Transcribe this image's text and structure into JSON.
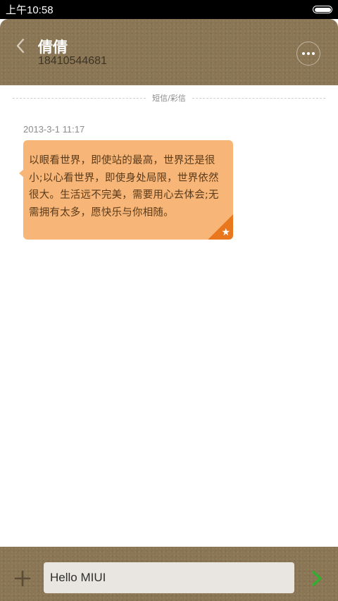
{
  "status_bar": {
    "time": "上午10:58"
  },
  "header": {
    "contact_name": "倩倩",
    "phone_number": "18410544681"
  },
  "conversation": {
    "divider_label": "短信/彩信",
    "messages": [
      {
        "timestamp": "2013-3-1 11:17",
        "text": "以眼看世界，即使站的最高，世界还是很小;以心看世界，即使身处局限，世界依然很大。生活远不完美，需要用心去体会;无需拥有太多，愿快乐与你相随。",
        "starred": true
      }
    ]
  },
  "composer": {
    "input_value": "Hello MIUI"
  },
  "colors": {
    "header_bg": "#8a7654",
    "bubble_bg": "#f7b677",
    "star_corner": "#e9771e",
    "send_arrow": "#2fb12f"
  },
  "icons": {
    "back": "chevron-left-icon",
    "more": "more-dots-icon",
    "attach": "plus-icon",
    "send": "chevron-right-icon",
    "star": "star-icon",
    "battery": "battery-icon"
  }
}
